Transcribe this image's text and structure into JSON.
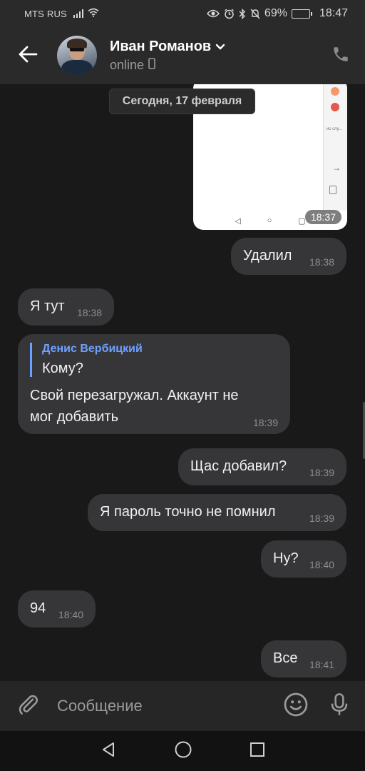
{
  "status_bar": {
    "carrier": "MTS RUS",
    "battery": "69%",
    "time": "18:47",
    "battery_level": 0.69
  },
  "header": {
    "contact_name": "Иван Романов",
    "status": "online"
  },
  "chat": {
    "date_divider": "Сегодня, 17 февраля",
    "image_message": {
      "time": "18:37"
    },
    "messages": [
      {
        "direction": "out",
        "text": "Удалил",
        "time": "18:38"
      },
      {
        "direction": "in",
        "text": "Я тут",
        "time": "18:38"
      },
      {
        "direction": "in",
        "reply_author": "Денис Вербицкий",
        "reply_text": "Кому?",
        "text_line1": "Свой перезагружал. Аккаунт не",
        "text_line2": "мог добавить",
        "time": "18:39"
      },
      {
        "direction": "out",
        "text": "Щас добавил?",
        "time": "18:39"
      },
      {
        "direction": "out",
        "text": "Я пароль точно не помнил",
        "time": "18:39"
      },
      {
        "direction": "out",
        "text": "Ну?",
        "time": "18:40"
      },
      {
        "direction": "in",
        "text": "94",
        "time": "18:40"
      },
      {
        "direction": "out",
        "text": "Все",
        "time": "18:41"
      }
    ]
  },
  "composer": {
    "placeholder": "Сообщение"
  },
  "colors": {
    "background": "#19191a",
    "bubble": "#363638",
    "accent": "#6ea0ff",
    "header": "#2a2a2b"
  },
  "icons": [
    "back-arrow-icon",
    "chevron-down-icon",
    "mobile-device-icon",
    "phone-icon",
    "paperclip-icon",
    "emoji-icon",
    "microphone-icon",
    "nav-back-icon",
    "nav-home-icon",
    "nav-recents-icon"
  ]
}
